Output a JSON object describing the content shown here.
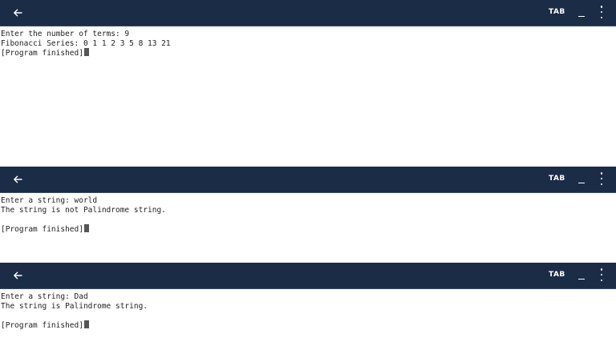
{
  "panels": [
    {
      "toolbar": {
        "tab_label": "TAB"
      },
      "lines": [
        "Enter the number of terms: 9",
        "Fibonacci Series: 0 1 1 2 3 5 8 13 21",
        "[Program finished]"
      ]
    },
    {
      "toolbar": {
        "tab_label": "TAB"
      },
      "lines": [
        "Enter a string: world",
        "The string is not Palindrome string.",
        "",
        "[Program finished]"
      ]
    },
    {
      "toolbar": {
        "tab_label": "TAB"
      },
      "lines": [
        "Enter a string: Dad",
        "The string is Palindrome string.",
        "",
        "[Program finished]"
      ]
    }
  ],
  "icons": {
    "back": "arrow-left-icon",
    "minimize": "minimize-icon",
    "more": "more-vert-icon"
  },
  "colors": {
    "toolbar_bg": "#1b2c46",
    "toolbar_fg": "#ffffff",
    "terminal_bg": "#ffffff",
    "terminal_fg": "#222222"
  }
}
